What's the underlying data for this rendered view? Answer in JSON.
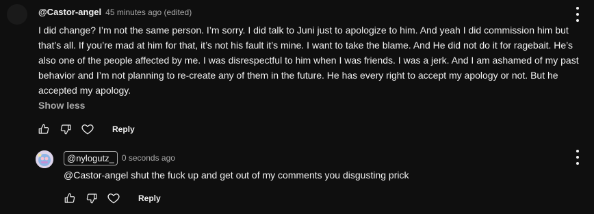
{
  "main_comment": {
    "author": "@Castor-angel",
    "meta": "45 minutes ago (edited)",
    "text": "I did change? I’m not the same person. I’m sorry. I did talk to Juni just to apologize to him. And yeah I did commission him but that’s all. If you’re mad at him for that, it’s not his fault it’s mine. I want to take the blame. And He did not do it for ragebait. He’s also one of the people affected by me. I was disrespectful to him when I was friends. I was a jerk. And I am ashamed of my past behavior and I’m not planning to re-create any of them in the future. He has every right to accept my apology or not. But he accepted my apology.",
    "show_less_label": "Show less",
    "reply_label": "Reply"
  },
  "reply_comment": {
    "author": "@nylogutz_",
    "meta": "0 seconds ago",
    "text": "@Castor-angel shut the fuck up and get out of my comments you disgusting prick",
    "reply_label": "Reply"
  },
  "icons": {
    "like": "thumbs-up-icon",
    "dislike": "thumbs-down-icon",
    "heart": "heart-icon",
    "more": "more-vertical-icon"
  },
  "colors": {
    "background": "#0f0f0f",
    "text": "#f1f1f1",
    "secondary_text": "#aaaaaa"
  }
}
